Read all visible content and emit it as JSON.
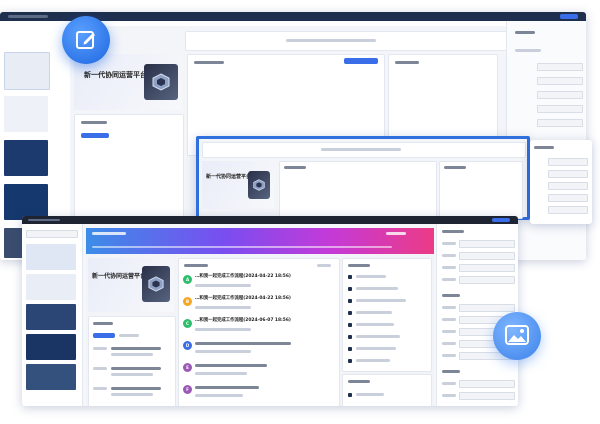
{
  "banner": {
    "title": "新一代协同运营平台",
    "subtitle": "",
    "subtitle_small": ""
  },
  "task_items_front": [
    {
      "title": "…和我一起完成工作流程(2024-04-22 18:56)",
      "avatar": "A",
      "color": "#2dbe6c"
    },
    {
      "title": "…和我一起完成工作流程(2024-04-22 18:56)",
      "avatar": "B",
      "color": "#f5a623"
    },
    {
      "title": "…和我一起完成工作流程(2024-06-07 18:56)",
      "avatar": "C",
      "color": "#2dbe6c"
    },
    {
      "title": "",
      "avatar": "D",
      "color": "#3a6ee8"
    },
    {
      "title": "",
      "avatar": "E",
      "color": "#9b59b6"
    },
    {
      "title": "",
      "avatar": "F",
      "color": "#9b59b6"
    }
  ],
  "task_items_mid": [
    {
      "title": "",
      "avatar": "A",
      "color": "#2dbe6c"
    },
    {
      "title": "",
      "avatar": "B",
      "color": "#f5a623"
    },
    {
      "title": "",
      "avatar": "C",
      "color": "#2dbe6c"
    }
  ],
  "task_items_back": [
    {
      "title": "",
      "avatar": "A",
      "color": "#3a6ee8"
    },
    {
      "title": "",
      "avatar": "B",
      "color": "#2dbe6c"
    },
    {
      "title": "",
      "avatar": "C",
      "color": "#f5a623"
    },
    {
      "title": "",
      "avatar": "D",
      "color": "#2dbe6c"
    }
  ],
  "icons": {
    "edit_badge": "edit-icon",
    "image_badge": "image-icon"
  },
  "colors": {
    "accent": "#3a6ee8",
    "dark": "#1f2f4e",
    "front_top": "#1e2431"
  }
}
